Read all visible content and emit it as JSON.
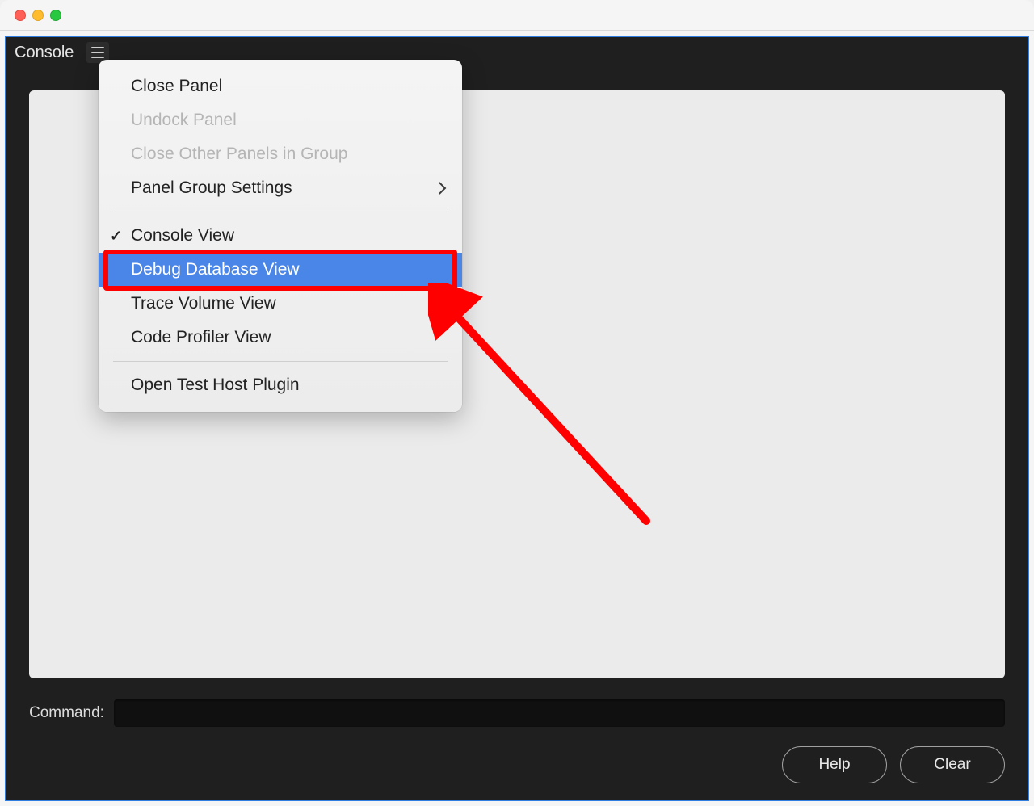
{
  "titlebar": {},
  "panel": {
    "tab_title": "Console"
  },
  "menu": {
    "items": [
      {
        "label": "Close Panel",
        "type": "item"
      },
      {
        "label": "Undock Panel",
        "type": "disabled"
      },
      {
        "label": "Close Other Panels in Group",
        "type": "disabled"
      },
      {
        "label": "Panel Group Settings",
        "type": "submenu"
      },
      {
        "divider": true
      },
      {
        "label": "Console View",
        "type": "checked"
      },
      {
        "label": "Debug Database View",
        "type": "highlight"
      },
      {
        "label": "Trace Volume View",
        "type": "item"
      },
      {
        "label": "Code Profiler View",
        "type": "item"
      },
      {
        "divider": true
      },
      {
        "label": "Open Test Host Plugin",
        "type": "item"
      }
    ]
  },
  "command": {
    "label": "Command:",
    "value": ""
  },
  "buttons": {
    "help": "Help",
    "clear": "Clear"
  }
}
